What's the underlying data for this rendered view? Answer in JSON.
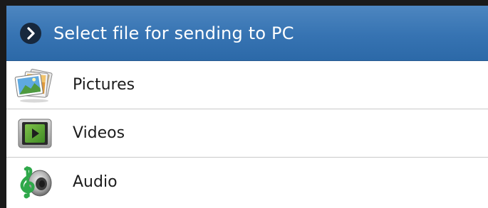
{
  "dialog": {
    "title": "Select file for sending to PC",
    "title_icon": "chevron-right-icon",
    "items": [
      {
        "label": "Pictures",
        "icon": "pictures-icon"
      },
      {
        "label": "Videos",
        "icon": "videos-icon"
      },
      {
        "label": "Audio",
        "icon": "audio-icon"
      }
    ]
  },
  "colors": {
    "title_bar": "#3673b2",
    "title_icon_bg": "#17283d",
    "divider": "#c9c9c9",
    "list_bg": "#ffffff"
  }
}
